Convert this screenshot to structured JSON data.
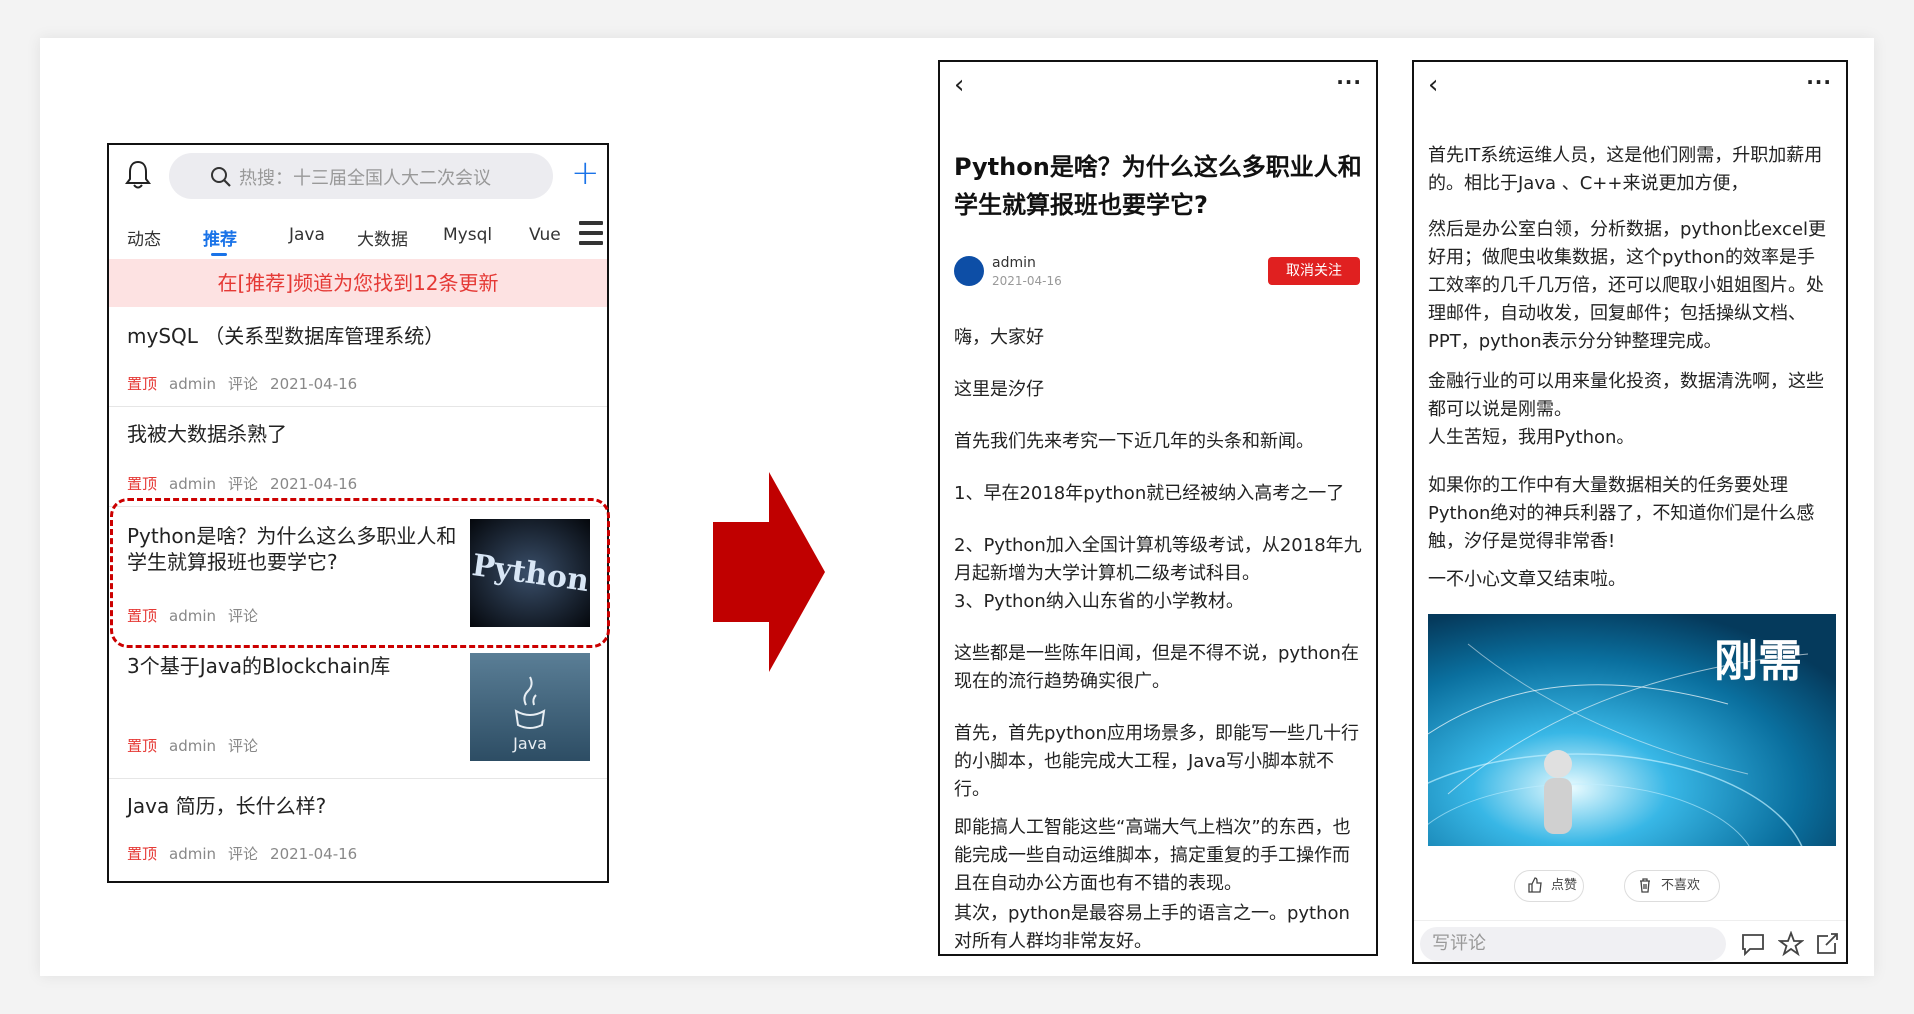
{
  "list_screen": {
    "search_placeholder": "热搜：十三届全国人大二次会议",
    "tabs": [
      {
        "label": "动态"
      },
      {
        "label": "推荐"
      },
      {
        "label": "Java"
      },
      {
        "label": "大数据"
      },
      {
        "label": "Mysql"
      },
      {
        "label": "Vue"
      }
    ],
    "active_tab": "推荐",
    "notice": "在[推荐]频道为您找到12条更新",
    "items": [
      {
        "title": "mySQL （关系型数据库管理系统）",
        "pin": "置顶",
        "author": "admin",
        "comment": "评论",
        "date": "2021-04-16"
      },
      {
        "title": "我被大数据杀熟了",
        "pin": "置顶",
        "author": "admin",
        "comment": "评论",
        "date": "2021-04-16"
      },
      {
        "title": "Python是啥？为什么这么多职业人和学生就算报班也要学它?",
        "pin": "置顶",
        "author": "admin",
        "comment": "评论",
        "thumb_text": "Python"
      },
      {
        "title": "3个基于Java的Blockchain库",
        "pin": "置顶",
        "author": "admin",
        "comment": "评论",
        "thumb_text": "Java"
      },
      {
        "title": "Java 简历，长什么样?",
        "pin": "置顶",
        "author": "admin",
        "comment": "评论",
        "date": "2021-04-16"
      }
    ]
  },
  "article_screen": {
    "title": "Python是啥？为什么这么多职业人和学生就算报班也要学它?",
    "author": "admin",
    "date": "2021-04-16",
    "unfollow_label": "取消关注",
    "paragraphs": [
      "嗨，大家好",
      "这里是汐仔",
      "首先我们先来考究一下近几年的头条和新闻。",
      "1、早在2018年python就已经被纳入高考之一了",
      "2、Python加入全国计算机等级考试，从2018年九月起新增为大学计算机二级考试科目。",
      "3、Python纳入山东省的小学教材。",
      "这些都是一些陈年旧闻，但是不得不说，python在现在的流行趋势确实很广。",
      "首先，首先python应用场景多，即能写一些几十行的小脚本，也能完成大工程，Java写小脚本就不行。",
      "即能搞人工智能这些“高端大气上档次”的东西，也能完成一些自动运维脚本，搞定重复的手工操作而且在自动办公方面也有不错的表现。",
      "其次，python是最容易上手的语言之一。python对所有人群均非常友好。"
    ]
  },
  "article_screen2": {
    "paragraphs": [
      "首先IT系统运维人员，这是他们刚需，升职加薪用的。相比于Java 、C++来说更加方便，",
      "然后是办公室白领，分析数据，python比excel更好用；做爬虫收集数据，这个python的效率是手工效率的几千几万倍，还可以爬取小姐姐图片。处理邮件，自动收发，回复邮件；包括操纵文档、PPT，python表示分分钟整理完成。",
      "金融行业的可以用来量化投资，数据清洗啊，这些都可以说是刚需。",
      "人生苦短，我用Python。",
      "如果你的工作中有大量数据相关的任务要处理Python绝对的神兵利器了，不知道你们是什么感触，汐仔是觉得非常香!",
      "一不小心文章又结束啦。"
    ],
    "image_text": "刚需",
    "like_label": "点赞",
    "dislike_label": "不喜欢",
    "comment_placeholder": "写评论"
  },
  "colors": {
    "accent_blue": "#1a73e8",
    "pin_red": "#e53935",
    "arrow_red": "#c00000",
    "notice_bg": "#fde2e2"
  },
  "icons": [
    "bell-icon",
    "search-icon",
    "plus-icon",
    "menu-icon",
    "back-icon",
    "more-icon",
    "like-icon",
    "trash-icon",
    "comment-icon",
    "star-icon",
    "share-icon"
  ]
}
